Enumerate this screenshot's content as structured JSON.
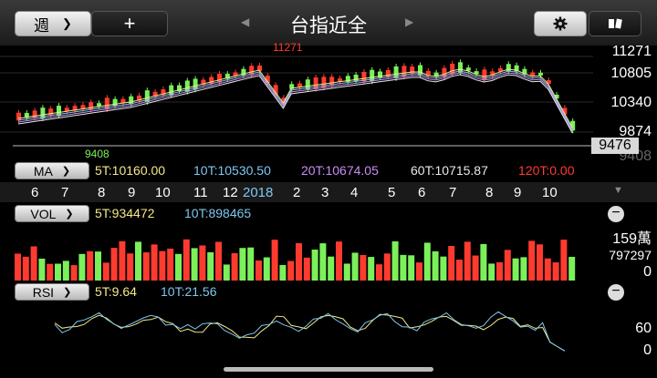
{
  "header": {
    "period_label": "週",
    "period_chevron": "❯",
    "add_label": "+",
    "title": "台指近全",
    "left_arrow": "◀",
    "right_arrow": "▶",
    "settings_icon": "gear-icon",
    "switch_icon": "switch-icon"
  },
  "price_axis": [
    "11271",
    "10805",
    "10340",
    "9874",
    "9408"
  ],
  "current_price": "9476",
  "high_marker": "11271",
  "low_marker": "9408",
  "ma_bar": {
    "label": "MA",
    "items": [
      {
        "text": "5T:10160.00",
        "color": "#f5e88a"
      },
      {
        "text": "10T:10530.50",
        "color": "#7ec8f0"
      },
      {
        "text": "20T:10674.05",
        "color": "#c78ef5"
      },
      {
        "text": "60T:10715.87",
        "color": "#e8e8e8"
      },
      {
        "text": "120T:0.00",
        "color": "#ff3b30"
      }
    ]
  },
  "months": [
    {
      "text": "6",
      "year": false
    },
    {
      "text": "7",
      "year": false
    },
    {
      "text": "8",
      "year": false
    },
    {
      "text": "9",
      "year": false
    },
    {
      "text": "10",
      "year": false
    },
    {
      "text": "11",
      "year": false
    },
    {
      "text": "12",
      "year": false
    },
    {
      "text": "2018",
      "year": true
    },
    {
      "text": "2",
      "year": false
    },
    {
      "text": "3",
      "year": false
    },
    {
      "text": "4",
      "year": false
    },
    {
      "text": "5",
      "year": false
    },
    {
      "text": "6",
      "year": false
    },
    {
      "text": "7",
      "year": false
    },
    {
      "text": "8",
      "year": false
    },
    {
      "text": "9",
      "year": false
    },
    {
      "text": "10",
      "year": false
    }
  ],
  "vol_bar": {
    "label": "VOL",
    "item1": "5T:934472",
    "item2": "10T:898465"
  },
  "vol_axis": [
    "159萬",
    "797297",
    "0"
  ],
  "rsi_bar": {
    "label": "RSI",
    "item1": "5T:9.64",
    "item2": "10T:21.56"
  },
  "rsi_axis": [
    "60",
    "0"
  ],
  "colors": {
    "up": "#ff3b30",
    "down": "#7cf05a",
    "rsi5": "#f5e88a",
    "rsi10": "#7ec8f0"
  }
}
